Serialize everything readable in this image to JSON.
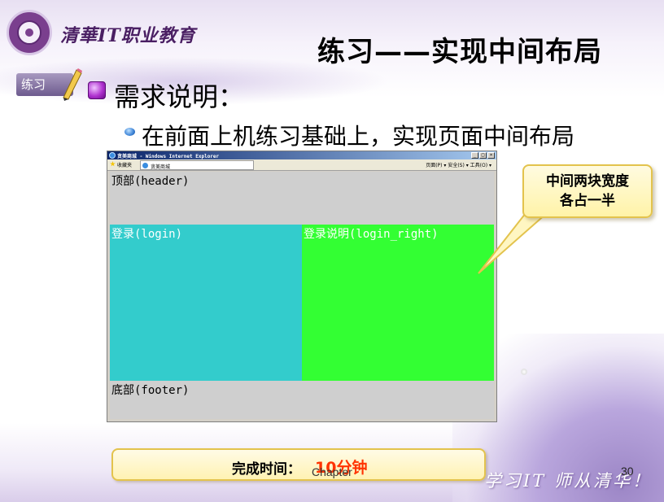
{
  "header": {
    "brand": "清華IT职业教育",
    "title": "练习——实现中间布局"
  },
  "badge": {
    "label": "练习"
  },
  "content": {
    "heading": "需求说明：",
    "subheading": "在前面上机练习基础上，实现页面中间布局"
  },
  "browser": {
    "window_title": "贪美商城 - Windows Internet Explorer",
    "favorites": "收藏夹",
    "tab_title": "贪美商城",
    "toolbar_tools": "页面(P) ▾  安全(S) ▾  工具(O) ▾",
    "regions": {
      "header": "顶部(header)",
      "login": "登录(login)",
      "login_right": "登录说明(login_right)",
      "footer": "底部(footer)"
    },
    "colors": {
      "header": "#cfcfcf",
      "login": "#33cccc",
      "login_right": "#33ff33",
      "footer": "#cfcfcf"
    }
  },
  "callout": {
    "line1": "中间两块宽度",
    "line2": "各占一半"
  },
  "footer": {
    "time_label": "完成时间：",
    "time_value": "10分钟",
    "chapter": "Chapter",
    "page": "30",
    "slogan": "学习IT 师从清华！"
  }
}
